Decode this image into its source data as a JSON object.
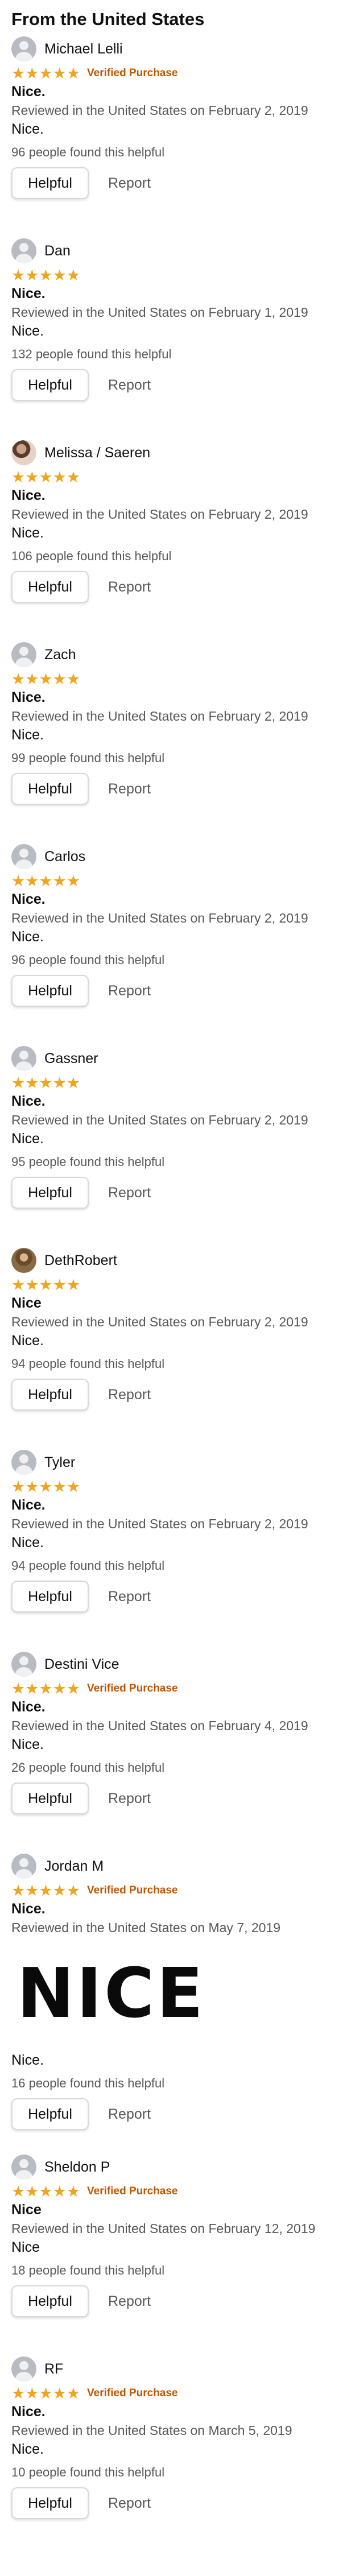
{
  "section_title": "From the United States",
  "stars_glyph": "★★★★★",
  "helpful_label": "Helpful",
  "report_label": "Report",
  "reviews": [
    {
      "name": "Michael Lelli",
      "verified": "Verified Purchase",
      "title": "Nice.",
      "meta": "Reviewed in the United States on February 2, 2019",
      "body": "Nice.",
      "helpful": "96 people found this helpful",
      "avatar": "default"
    },
    {
      "name": "Dan",
      "verified": "",
      "title": "Nice.",
      "meta": "Reviewed in the United States on February 1, 2019",
      "body": "Nice.",
      "helpful": "132 people found this helpful",
      "avatar": "default"
    },
    {
      "name": "Melissa / Saeren",
      "verified": "",
      "title": "Nice.",
      "meta": "Reviewed in the United States on February 2, 2019",
      "body": "Nice.",
      "helpful": "106 people found this helpful",
      "avatar": "photo"
    },
    {
      "name": "Zach",
      "verified": "",
      "title": "Nice.",
      "meta": "Reviewed in the United States on February 2, 2019",
      "body": "Nice.",
      "helpful": "99 people found this helpful",
      "avatar": "default"
    },
    {
      "name": "Carlos",
      "verified": "",
      "title": "Nice.",
      "meta": "Reviewed in the United States on February 2, 2019",
      "body": "Nice.",
      "helpful": "96 people found this helpful",
      "avatar": "default"
    },
    {
      "name": "Gassner",
      "verified": "",
      "title": "Nice.",
      "meta": "Reviewed in the United States on February 2, 2019",
      "body": "Nice.",
      "helpful": "95 people found this helpful",
      "avatar": "default"
    },
    {
      "name": "DethRobert",
      "verified": "",
      "title": "Nice",
      "meta": "Reviewed in the United States on February 2, 2019",
      "body": "Nice.",
      "helpful": "94 people found this helpful",
      "avatar": "photo2"
    },
    {
      "name": "Tyler",
      "verified": "",
      "title": "Nice.",
      "meta": "Reviewed in the United States on February 2, 2019",
      "body": "Nice.",
      "helpful": "94 people found this helpful",
      "avatar": "default"
    },
    {
      "name": "Destini Vice",
      "verified": "Verified Purchase",
      "title": "Nice.",
      "meta": "Reviewed in the United States on February 4, 2019",
      "body": "Nice.",
      "helpful": "26 people found this helpful",
      "avatar": "default"
    },
    {
      "name": "Jordan M",
      "verified": "Verified Purchase",
      "title": "Nice.",
      "meta": "Reviewed in the United States on May 7, 2019",
      "image_text": "NICE",
      "body": "Nice.",
      "helpful": "16 people found this helpful",
      "avatar": "default"
    },
    {
      "name": "Sheldon P",
      "verified": "Verified Purchase",
      "title": "Nice",
      "meta": "Reviewed in the United States on February 12, 2019",
      "body": "Nice",
      "helpful": "18 people found this helpful",
      "avatar": "default"
    },
    {
      "name": "RF",
      "verified": "Verified Purchase",
      "title": "Nice.",
      "meta": "Reviewed in the United States on March 5, 2019",
      "body": "Nice.",
      "helpful": "10 people found this helpful",
      "avatar": "default"
    }
  ]
}
